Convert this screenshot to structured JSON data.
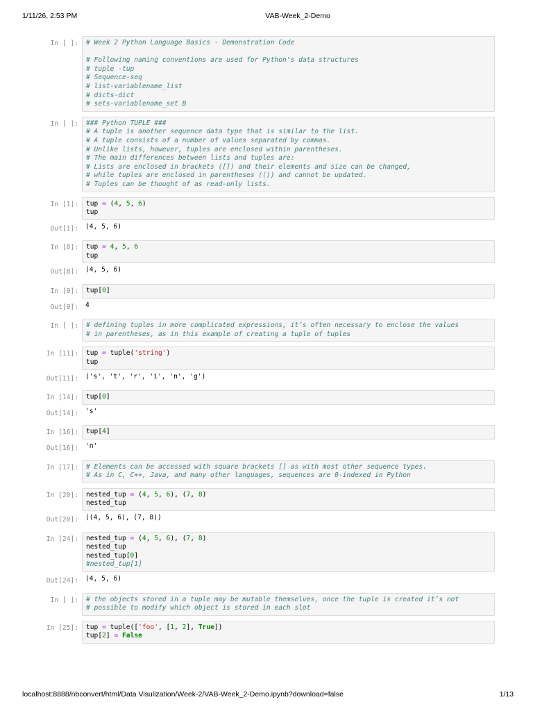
{
  "header": {
    "datetime": "1/11/26, 2:53 PM",
    "title": "VAB-Week_2-Demo"
  },
  "footer": {
    "url": "localhost:8888/nbconvert/html/Data Visulization/Week-2/VAB-Week_2-Demo.ipynb?download=false",
    "page": "1/13"
  },
  "cells": [
    {
      "prompt": "In [ ]:",
      "lines": [
        [
          {
            "t": "# Week 2 Python Language Basics - Demonstration Code",
            "c": "comment"
          }
        ],
        [],
        [
          {
            "t": "# Following naming conventions are used for Python's data structures",
            "c": "comment"
          }
        ],
        [
          {
            "t": "# tuple -tup",
            "c": "comment"
          }
        ],
        [
          {
            "t": "# Sequence-seq",
            "c": "comment"
          }
        ],
        [
          {
            "t": "# list-variablename_list",
            "c": "comment"
          }
        ],
        [
          {
            "t": "# dicts-dict",
            "c": "comment"
          }
        ],
        [
          {
            "t": "# sets-variablename_set B",
            "c": "comment"
          }
        ]
      ]
    },
    {
      "prompt": "In [ ]:",
      "lines": [
        [
          {
            "t": "### Python TUPLE ###",
            "c": "comment"
          }
        ],
        [
          {
            "t": "# A tuple is another sequence data type that is similar to the list.",
            "c": "comment"
          }
        ],
        [
          {
            "t": "# A tuple consists of a number of values separated by commas.",
            "c": "comment"
          }
        ],
        [
          {
            "t": "# Unlike lists, however, tuples are enclosed within parentheses.",
            "c": "comment"
          }
        ],
        [
          {
            "t": "# The main differences between lists and tuples are:",
            "c": "comment"
          }
        ],
        [
          {
            "t": "# Lists are enclosed in brackets ([]) and their elements and size can be changed,",
            "c": "comment"
          }
        ],
        [
          {
            "t": "# while tuples are enclosed in parentheses (()) and cannot be updated.",
            "c": "comment"
          }
        ],
        [
          {
            "t": "# Tuples can be thought of as read-only lists.",
            "c": "comment"
          }
        ]
      ]
    },
    {
      "prompt": "In [1]:",
      "lines": [
        [
          {
            "t": "tup ",
            "c": "name"
          },
          {
            "t": "=",
            "c": "op"
          },
          {
            "t": " (",
            "c": "name"
          },
          {
            "t": "4",
            "c": "num"
          },
          {
            "t": ", ",
            "c": "name"
          },
          {
            "t": "5",
            "c": "num"
          },
          {
            "t": ", ",
            "c": "name"
          },
          {
            "t": "6",
            "c": "num"
          },
          {
            "t": ")",
            "c": "name"
          }
        ],
        [
          {
            "t": "tup",
            "c": "name"
          }
        ]
      ],
      "out_prompt": "Out[1]:",
      "output": "(4, 5, 6)"
    },
    {
      "prompt": "In [8]:",
      "lines": [
        [
          {
            "t": "tup ",
            "c": "name"
          },
          {
            "t": "=",
            "c": "op"
          },
          {
            "t": " ",
            "c": "name"
          },
          {
            "t": "4",
            "c": "num"
          },
          {
            "t": ", ",
            "c": "name"
          },
          {
            "t": "5",
            "c": "num"
          },
          {
            "t": ", ",
            "c": "name"
          },
          {
            "t": "6",
            "c": "num"
          }
        ],
        [
          {
            "t": "tup",
            "c": "name"
          }
        ]
      ],
      "out_prompt": "Out[8]:",
      "output": "(4, 5, 6)"
    },
    {
      "prompt": "In [9]:",
      "lines": [
        [
          {
            "t": "tup[",
            "c": "name"
          },
          {
            "t": "0",
            "c": "num"
          },
          {
            "t": "]",
            "c": "name"
          }
        ]
      ],
      "out_prompt": "Out[9]:",
      "output": "4"
    },
    {
      "prompt": "In [ ]:",
      "lines": [
        [
          {
            "t": "# defining tuples in more complicated expressions, it’s often necessary to enclose the values",
            "c": "comment"
          }
        ],
        [
          {
            "t": "# in parentheses, as in this example of creating a tuple of tuples",
            "c": "comment"
          }
        ]
      ]
    },
    {
      "prompt": "In [11]:",
      "lines": [
        [
          {
            "t": "tup ",
            "c": "name"
          },
          {
            "t": "=",
            "c": "op"
          },
          {
            "t": " tuple(",
            "c": "name"
          },
          {
            "t": "'string'",
            "c": "str"
          },
          {
            "t": ")",
            "c": "name"
          }
        ],
        [
          {
            "t": "tup",
            "c": "name"
          }
        ]
      ],
      "out_prompt": "Out[11]:",
      "output": "('s', 't', 'r', 'i', 'n', 'g')"
    },
    {
      "prompt": "In [14]:",
      "lines": [
        [
          {
            "t": "tup[",
            "c": "name"
          },
          {
            "t": "0",
            "c": "num"
          },
          {
            "t": "]",
            "c": "name"
          }
        ]
      ],
      "out_prompt": "Out[14]:",
      "output": "'s'"
    },
    {
      "prompt": "In [16]:",
      "lines": [
        [
          {
            "t": "tup[",
            "c": "name"
          },
          {
            "t": "4",
            "c": "num"
          },
          {
            "t": "]",
            "c": "name"
          }
        ]
      ],
      "out_prompt": "Out[16]:",
      "output": "'n'"
    },
    {
      "prompt": "In [17]:",
      "lines": [
        [
          {
            "t": "# Elements can be accessed with square brackets [] as with most other sequence types.",
            "c": "comment"
          }
        ],
        [
          {
            "t": "# As in C, C++, Java, and many other languages, sequences are 0-indexed in Python",
            "c": "comment"
          }
        ]
      ]
    },
    {
      "prompt": "In [20]:",
      "lines": [
        [
          {
            "t": "nested_tup ",
            "c": "name"
          },
          {
            "t": "=",
            "c": "op"
          },
          {
            "t": " (",
            "c": "name"
          },
          {
            "t": "4",
            "c": "num"
          },
          {
            "t": ", ",
            "c": "name"
          },
          {
            "t": "5",
            "c": "num"
          },
          {
            "t": ", ",
            "c": "name"
          },
          {
            "t": "6",
            "c": "num"
          },
          {
            "t": "), (",
            "c": "name"
          },
          {
            "t": "7",
            "c": "num"
          },
          {
            "t": ", ",
            "c": "name"
          },
          {
            "t": "8",
            "c": "num"
          },
          {
            "t": ")",
            "c": "name"
          }
        ],
        [
          {
            "t": "nested_tup",
            "c": "name"
          }
        ]
      ],
      "out_prompt": "Out[20]:",
      "output": "((4, 5, 6), (7, 8))"
    },
    {
      "prompt": "In [24]:",
      "lines": [
        [
          {
            "t": "nested_tup ",
            "c": "name"
          },
          {
            "t": "=",
            "c": "op"
          },
          {
            "t": " (",
            "c": "name"
          },
          {
            "t": "4",
            "c": "num"
          },
          {
            "t": ", ",
            "c": "name"
          },
          {
            "t": "5",
            "c": "num"
          },
          {
            "t": ", ",
            "c": "name"
          },
          {
            "t": "6",
            "c": "num"
          },
          {
            "t": "), (",
            "c": "name"
          },
          {
            "t": "7",
            "c": "num"
          },
          {
            "t": ", ",
            "c": "name"
          },
          {
            "t": "8",
            "c": "num"
          },
          {
            "t": ")",
            "c": "name"
          }
        ],
        [
          {
            "t": "nested_tup",
            "c": "name"
          }
        ],
        [
          {
            "t": "nested_tup[",
            "c": "name"
          },
          {
            "t": "0",
            "c": "num"
          },
          {
            "t": "]",
            "c": "name"
          }
        ],
        [
          {
            "t": "#nested_tup[1]",
            "c": "comment"
          }
        ]
      ],
      "out_prompt": "Out[24]:",
      "output": "(4, 5, 6)"
    },
    {
      "prompt": "In [ ]:",
      "lines": [
        [
          {
            "t": "# the objects stored in a tuple may be mutable themselves, once the tuple is created it’s not",
            "c": "comment"
          }
        ],
        [
          {
            "t": "# possible to modify which object is stored in each slot",
            "c": "comment"
          }
        ]
      ]
    },
    {
      "prompt": "In [25]:",
      "lines": [
        [
          {
            "t": "tup ",
            "c": "name"
          },
          {
            "t": "=",
            "c": "op"
          },
          {
            "t": " tuple([",
            "c": "name"
          },
          {
            "t": "'foo'",
            "c": "str"
          },
          {
            "t": ", [",
            "c": "name"
          },
          {
            "t": "1",
            "c": "num"
          },
          {
            "t": ", ",
            "c": "name"
          },
          {
            "t": "2",
            "c": "num"
          },
          {
            "t": "], ",
            "c": "name"
          },
          {
            "t": "True",
            "c": "kw"
          },
          {
            "t": "])",
            "c": "name"
          }
        ],
        [
          {
            "t": "tup[",
            "c": "name"
          },
          {
            "t": "2",
            "c": "num"
          },
          {
            "t": "] ",
            "c": "name"
          },
          {
            "t": "=",
            "c": "op"
          },
          {
            "t": " ",
            "c": "name"
          },
          {
            "t": "False",
            "c": "kw"
          }
        ]
      ]
    }
  ]
}
